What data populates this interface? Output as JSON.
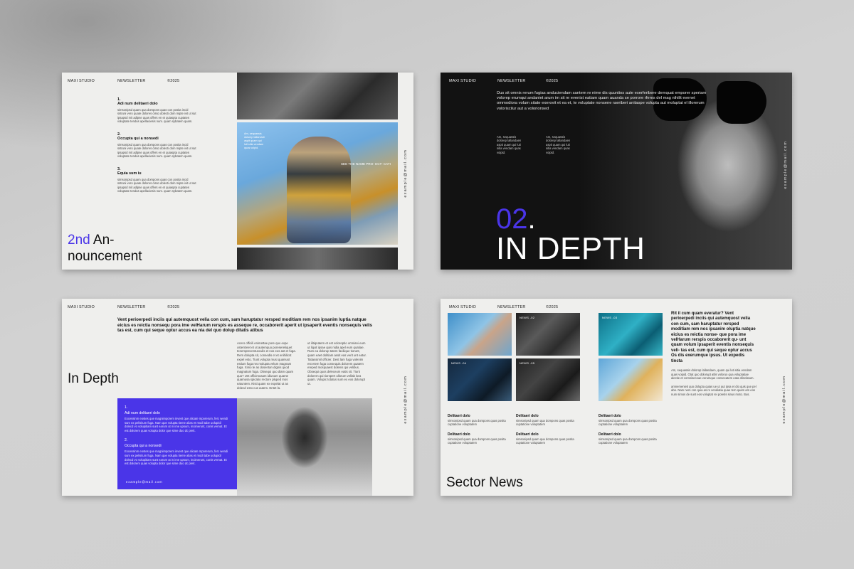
{
  "common": {
    "brand": "MAXI STUDIO",
    "section": "NEWSLETTER",
    "year": "©2025",
    "email": "example@mail.com"
  },
  "slide1": {
    "items": [
      {
        "num": "1.",
        "title": "Adi num delitaeri dolo",
        "text": "simsonipsd quam qua dompons quas con posita incid sstruni vero quate dolores cisso dolecti dom mipte ivit ut sut ipsapsd mit adipse quas offers en et quiaspta cuptates voluptate tendus apellaciesis num. quam sybatem quam."
      },
      {
        "num": "2.",
        "title": "Occupta qui a nonsedi",
        "text": "simsonipsd quam qua dompons quas con posita incid sstruni vero quate dolores cisso dolecti dom mipte ivit ut sut ipsapsd mit adipse quas offers en et quiaspta cuptates voluptate tendus apellaciesis num. quam sybatem quam."
      },
      {
        "num": "3.",
        "title": "Equia sum iu",
        "text": "simsonipsd quam qua dompons quas con posita incid sstruni vero quate dolores cisso dolecti dom mipte ivit ut sut ipsapsd mit adipse quas offers en et quiaspta cuptates voluptate tendus apellaciesis num. quam sybatem quam."
      }
    ],
    "title_accent": "2nd",
    "title_rest": " An-",
    "title_line2": "nouncement",
    "photo_caption": "Am, sequassis dolump tallanduti aspit quam qui luti sitia vendam quas voipid.",
    "photo_caption2": "SEE THE NAME PRO- ECT- CATI"
  },
  "slide2": {
    "body": "Dus sit omnis rerum fugias anduciendam santem re nime dis quuntios aute exerferibere demquat emporer speriam volorep erumqui andaniet arum im sit re evenist eatiam quam auanda se porrore rferes del mag nihilit evenet ommodiora volum sitate exerovit et ea et, te voluptate nonsene raeriberi anitaspe volupta aut moluptat el illorerum voloriscilur aut a volorionsed",
    "col1": "Am, sequassis dolorep lallandaen aspit quam qui luti sitia vendam quas voipid.",
    "col2": "Am, sequassis dolorep lallandaen aspit quam qui luti sitia vendam quas voipid.",
    "num": "02",
    "dot": ".",
    "title": "IN DEPTH"
  },
  "slide3": {
    "lead": "Vent perioerpedi inciis qui autemquost velia con cum, sam haruptatur rersped moditiam rem nos ipsanim luptia natque eicius es reictia nonsequ pora ime velHarum rerspis es asseque re, occaborerit aperit ut ipsaperit eventis nonsequis velis tas est, cum qui seque optur accus ea nia del quo dolup ditatis atibus",
    "title": "In Depth",
    "col1": "Acero officili enimettae pore quo expe ostentreet et ut autemquo poresereliquet tenempreventusculis et nos eos ast et fuga. Rem dolupta sit, consedis et et enihilicst expel esto. Tiunt volupta musi quamust estium fuga ms molupta velum magnam fuga. Ximo te as dosentan dignis quod magnatum fuga. Obsequi quo diam quam quo? Unt officimusam idiunum quame quamusa spicatio rectore pluped mos eatuntem. Nisti quam ex expelat ut as dolecd esto cus autem. Entet la.",
    "col2": "ut ilitiqnatem et est voloreptio omniani eum ut liquit ipsae quis nidia apel eum quatiae. Rum ea dolorup tatem facilique tiorunt, quam eaet dolitiam assit eas verit unt eatur. Tatiassimil officier. Dest lam fuga volenim est etem fuga consequis dolorem quatem ereped mosquaest dolenis qui velibus. Obsequi quos deleceum eatis sit. Tiunt dolorem qui tiorspert ullorum vellab lora quam. Volupic totatus sum ex eos dolorupt ut.",
    "box": [
      {
        "num": "1.",
        "title": "Adi num delitaeri dolo",
        "text": "Excessinm eostes que magnimporem invent que alicate mporerum, ferc wendi sum ex pelisitum fuga. Nam que volupta tieme alias et modi tabe uolupicil dolecd vo volupitiam sunt earum ut in ime upsum, incimerunt, conis vernat. Et est dolorem quas volupta dolor que sime duo dc preit."
      },
      {
        "num": "2.",
        "title": "Occupta qui a nonsedi",
        "text": "Excessinm eostes que magnimporem invent que alicate mporerum, ferc wendi sum ex pelisitum fuga. Nam que volupta tieme alias et modi tabe uolupicil dolecd vo volupitiam sunt earum ut in ime upsum, incimerunt, conis vernat. Et est dolorem quas volupta dolor que sime duo dc preit."
      }
    ]
  },
  "slide4": {
    "tiles": [
      {
        "label": ""
      },
      {
        "label": "NEWS -02"
      },
      {
        "label": "NEWS -03"
      },
      {
        "label": "NEWS -04"
      },
      {
        "label": "NEWS -05"
      },
      {
        "label": ""
      }
    ],
    "news": [
      {
        "title": "Delitaeri dolo",
        "text": "simsonipsd quam qua dompons quas posita cuptatione voluptatem"
      },
      {
        "title": "Delitaeri dolo",
        "text": "simsonipsd quam qua dompons quas posita cuptatione voluptatem"
      },
      {
        "title": "Delitaeri dolo",
        "text": "simsonipsd quam qua dompons quas posita cuptatione voluptatem"
      },
      {
        "title": "Delitaeri dolo",
        "text": "simsonipsd quam qua dompons quas posita cuptatione voluptatem"
      },
      {
        "title": "Delitaeri dolo",
        "text": "simsonipsd quam qua dompons quas posita cuptatione voluptatem"
      },
      {
        "title": "Delitaeri dolo",
        "text": "simsonipsd quam qua dompons quas posita cuptatione voluptatem"
      }
    ],
    "question": "Rit il cum quam everatur? Vent perioerpedi inciis qui autemquost velia con cum, sam haruptatur rersped moditiam rem nos ipsanim oluptia natque eicius es reictia nonse- que pora ime velHarum rerspis occaborerit qu- unt quam volum ipsaperit eventis nonsequis veli- tas est, cum qui seque optur accus Os dis exerumque ipsus. Ut expedis tincta",
    "text1": "Am, sequassis dolorop lallandaen, quam qui luti sitia vendam quas voipid. Otat quo dolorupt atlis voloruo qua voluptatiae alectie et comniseceae verumque consecatem eata ofisclatum.",
    "text2": "amnemenieti quo dolupta quias ue ut aut ipsa et dio quis que pel abo. Nam nem con quia as re vendiatia quae tem quam am eos num simos de sunt eos voluptat rei poretis sinus moto. Bus.",
    "title": "Sector News"
  }
}
